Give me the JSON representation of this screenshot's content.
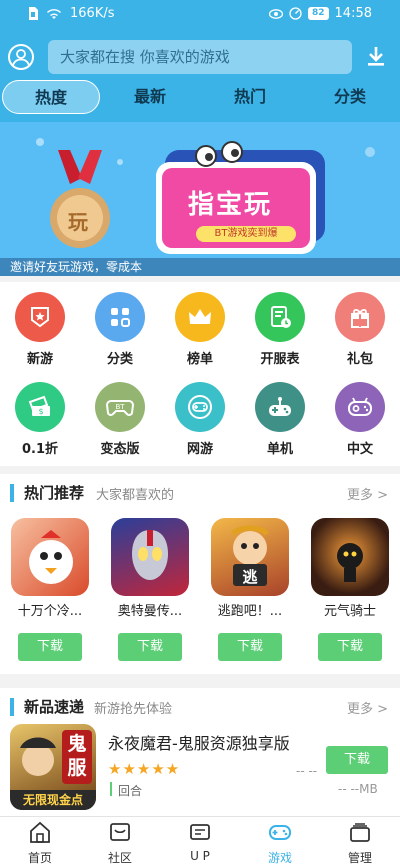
{
  "status_bar": {
    "speed": "166K/s",
    "battery": "82",
    "time": "14:58"
  },
  "search": {
    "placeholder": "大家都在搜 你喜欢的游戏"
  },
  "tabs": [
    {
      "label": "热度",
      "active": true
    },
    {
      "label": "最新",
      "active": false
    },
    {
      "label": "热门",
      "active": false
    },
    {
      "label": "分类",
      "active": false
    }
  ],
  "banner": {
    "main_text": "指宝玩",
    "sub_text": "BT游戏奕到爆",
    "medal_text": "玩",
    "caption": "邀请好友玩游戏，零成本"
  },
  "categories": [
    {
      "label": "新游",
      "icon": "star-shield-icon",
      "color": "#ee5a4a"
    },
    {
      "label": "分类",
      "icon": "grid-icon",
      "color": "#5aa8ee"
    },
    {
      "label": "榜单",
      "icon": "crown-icon",
      "color": "#f6b81c"
    },
    {
      "label": "开服表",
      "icon": "server-list-icon",
      "color": "#34c65b"
    },
    {
      "label": "礼包",
      "icon": "gift-icon",
      "color": "#f07f7a"
    },
    {
      "label": "0.1折",
      "icon": "discount-ticket-icon",
      "color": "#2fcb84"
    },
    {
      "label": "变态版",
      "icon": "bt-gamepad-icon",
      "color": "#93b571"
    },
    {
      "label": "网游",
      "icon": "online-gamepad-icon",
      "color": "#3bbfc9"
    },
    {
      "label": "单机",
      "icon": "joystick-icon",
      "color": "#3f9187"
    },
    {
      "label": "中文",
      "icon": "cn-gamepad-icon",
      "color": "#8d64b8"
    }
  ],
  "hot_section": {
    "title": "热门推荐",
    "subtitle": "大家都喜欢的",
    "more": "更多 >",
    "games": [
      {
        "name": "十万个冷...",
        "button": "下载",
        "colors": [
          "#f7c0a0",
          "#d94b2b"
        ]
      },
      {
        "name": "奥特曼传...",
        "button": "下载",
        "colors": [
          "#2a3f9a",
          "#c2263a"
        ]
      },
      {
        "name": "逃跑吧！...",
        "button": "下载",
        "colors": [
          "#f3b848",
          "#a8422a"
        ],
        "icon_text": "逃"
      },
      {
        "name": "元气骑士",
        "button": "下载",
        "colors": [
          "#3a1d12",
          "#e96a21"
        ]
      }
    ]
  },
  "new_section": {
    "title": "新品速递",
    "subtitle": "新游抢先体验",
    "more": "更多 >",
    "game": {
      "title": "永夜魔君-鬼服资源独享版",
      "stars": "★★★★★",
      "rating": "-- --",
      "tag": "回合",
      "size": "-- --MB",
      "button": "下载",
      "icon_text": "鬼服",
      "icon_banner": "无限现金点"
    }
  },
  "bottom_nav": [
    {
      "label": "首页",
      "active": false
    },
    {
      "label": "社区",
      "active": false
    },
    {
      "label": "U P",
      "active": false
    },
    {
      "label": "游戏",
      "active": true
    },
    {
      "label": "管理",
      "active": false
    }
  ]
}
